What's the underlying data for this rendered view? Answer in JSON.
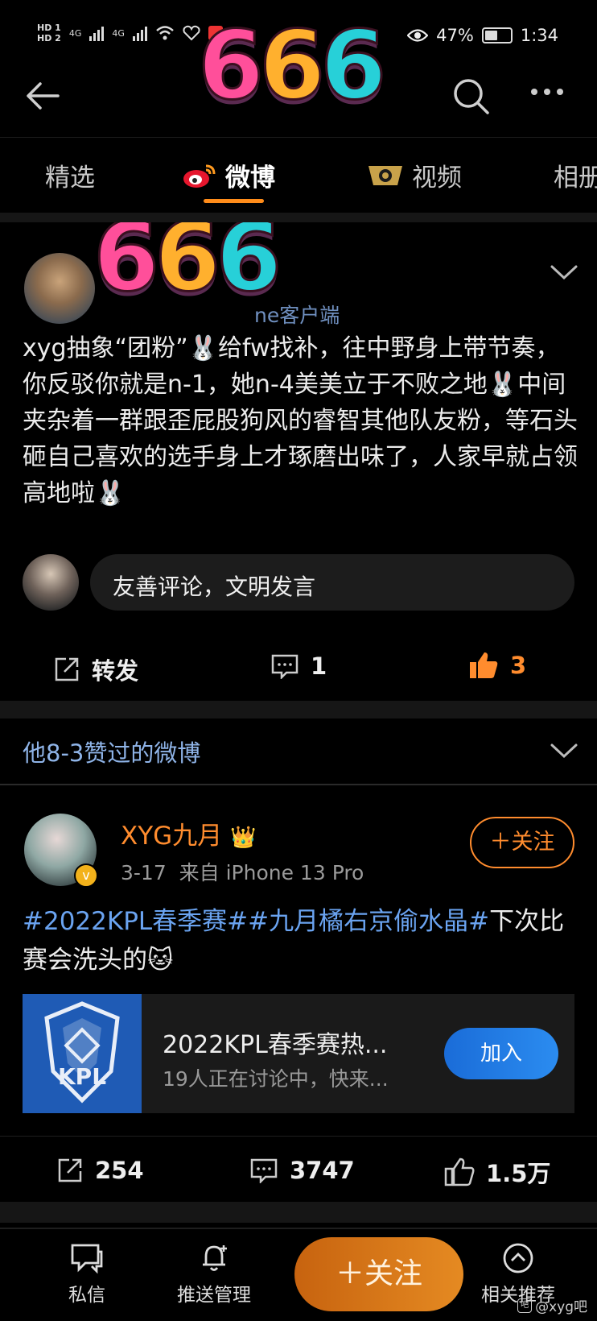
{
  "status_bar": {
    "hd1": "HD 1",
    "hd2": "HD 2",
    "net1": "4G",
    "net2": "4G",
    "battery": "47%",
    "time": "1:34"
  },
  "sticker_text": "666",
  "tabs": [
    {
      "label": "精选",
      "active": false
    },
    {
      "label": "微博",
      "active": true
    },
    {
      "label": "视频",
      "active": false
    },
    {
      "label": "相册",
      "active": false
    }
  ],
  "post1": {
    "source": "ne客户端",
    "text": "xyg抽象“团粉”🐰给fw找补，往中野身上带节奏，你反驳你就是n-1，她n-4美美立于不败之地🐰中间夹杂着一群跟歪屁股狗风的睿智其他队友粉，等石头砸自己喜欢的选手身上才琢磨出味了，人家早就占领高地啦🐰",
    "comment_placeholder": "友善评论，文明发言",
    "repost_label": "转发",
    "comments": "1",
    "likes": "3"
  },
  "section": {
    "title": "他8-3赞过的微博"
  },
  "post2": {
    "author": "XYG九月",
    "crown": "👑",
    "date": "3-17",
    "source": "来自 iPhone 13 Pro",
    "follow_label": "＋关注",
    "tag1": "#2022KPL春季赛#",
    "tag2": "#九月橘右京偷水晶#",
    "text_tail": "下次比赛会洗头的",
    "emoji": "🐱",
    "card": {
      "logo": "KPL",
      "title": "2022KPL春季赛热...",
      "subtitle": "19人正在讨论中，快来...",
      "join_label": "加入"
    },
    "reposts": "254",
    "comments": "3747",
    "likes": "1.5万"
  },
  "bottom_nav": {
    "messages": "私信",
    "push": "推送管理",
    "follow": "＋关注",
    "related": "相关推荐"
  },
  "watermark": {
    "logo": "吧",
    "text": "@xyg吧"
  },
  "colors": {
    "accent_orange": "#ff8c2e",
    "link_blue": "#6aa3f0",
    "join_blue": "#1a6cd8",
    "background": "#000000"
  }
}
